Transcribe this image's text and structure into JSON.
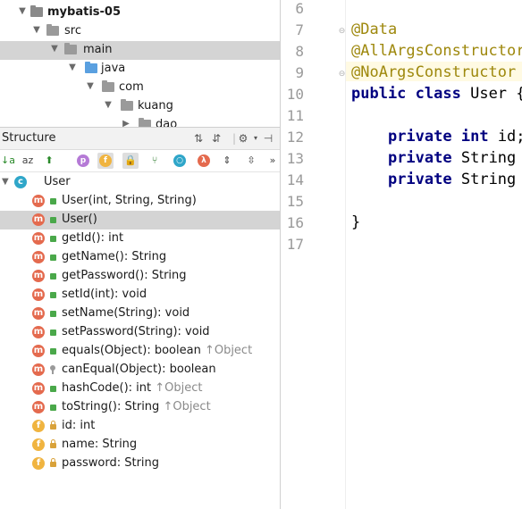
{
  "project_tree": {
    "items": [
      {
        "label": "mybatis-05",
        "bold": true
      },
      {
        "label": "src"
      },
      {
        "label": "main"
      },
      {
        "label": "java"
      },
      {
        "label": "com"
      },
      {
        "label": "kuang"
      },
      {
        "label": "dao"
      }
    ]
  },
  "structure": {
    "title": "Structure",
    "class_name": "User",
    "members": [
      {
        "label": "User(int, String, String)",
        "kind": "m",
        "vis": "pub",
        "inherited": ""
      },
      {
        "label": "User()",
        "kind": "m",
        "vis": "pub",
        "inherited": "",
        "selected": true
      },
      {
        "label": "getId(): int",
        "kind": "m",
        "vis": "pub",
        "inherited": ""
      },
      {
        "label": "getName(): String",
        "kind": "m",
        "vis": "pub",
        "inherited": ""
      },
      {
        "label": "getPassword(): String",
        "kind": "m",
        "vis": "pub",
        "inherited": ""
      },
      {
        "label": "setId(int): void",
        "kind": "m",
        "vis": "pub",
        "inherited": ""
      },
      {
        "label": "setName(String): void",
        "kind": "m",
        "vis": "pub",
        "inherited": ""
      },
      {
        "label": "setPassword(String): void",
        "kind": "m",
        "vis": "pub",
        "inherited": ""
      },
      {
        "label": "equals(Object): boolean",
        "kind": "m",
        "vis": "pub",
        "inherited": "↑Object"
      },
      {
        "label": "canEqual(Object): boolean",
        "kind": "m",
        "vis": "pkg",
        "inherited": ""
      },
      {
        "label": "hashCode(): int",
        "kind": "m",
        "vis": "pub",
        "inherited": "↑Object"
      },
      {
        "label": "toString(): String",
        "kind": "m",
        "vis": "pub",
        "inherited": "↑Object"
      },
      {
        "label": "id: int",
        "kind": "f",
        "vis": "priv",
        "inherited": ""
      },
      {
        "label": "name: String",
        "kind": "f",
        "vis": "priv",
        "inherited": ""
      },
      {
        "label": "password: String",
        "kind": "f",
        "vis": "priv",
        "inherited": ""
      }
    ]
  },
  "editor": {
    "current_line": 9,
    "lines": [
      {
        "num": "6",
        "code": ""
      },
      {
        "num": "7",
        "code": "@Data",
        "type": "ann"
      },
      {
        "num": "8",
        "code": "@AllArgsConstructor",
        "type": "ann"
      },
      {
        "num": "9",
        "code": "@NoArgsConstructor",
        "type": "ann"
      },
      {
        "num": "10",
        "code": "public class User {",
        "type": "class"
      },
      {
        "num": "11",
        "code": ""
      },
      {
        "num": "12",
        "code": "    private int id;",
        "type": "field"
      },
      {
        "num": "13",
        "code": "    private String name;",
        "type": "field"
      },
      {
        "num": "14",
        "code": "    private String password;",
        "type": "field"
      },
      {
        "num": "15",
        "code": ""
      },
      {
        "num": "16",
        "code": "}",
        "type": "plain"
      },
      {
        "num": "17",
        "code": ""
      }
    ]
  },
  "colors": {
    "annotation": "#9e880d",
    "keyword": "#000080",
    "method_badge": "#e46a4e",
    "field_badge": "#f0b440",
    "class_badge": "#2fa6c9",
    "current_line": "#fffae3"
  }
}
